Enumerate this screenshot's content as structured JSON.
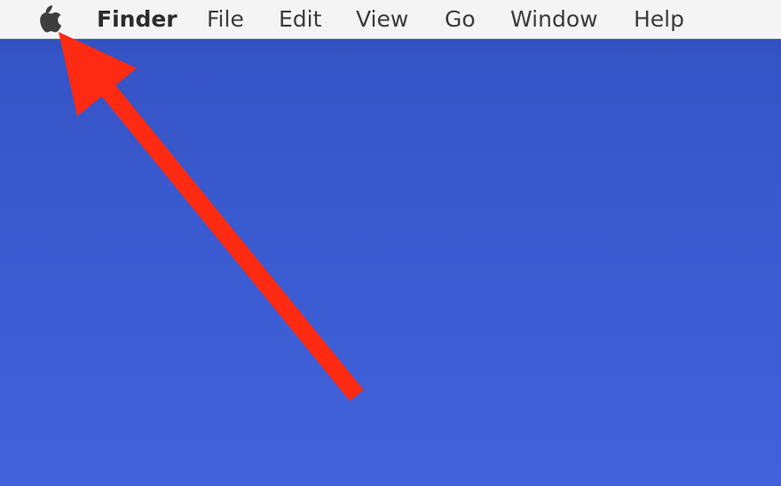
{
  "menubar": {
    "apple_icon": "apple-logo-icon",
    "items": [
      {
        "label": "Finder"
      },
      {
        "label": "File"
      },
      {
        "label": "Edit"
      },
      {
        "label": "View"
      },
      {
        "label": "Go"
      },
      {
        "label": "Window"
      },
      {
        "label": "Help"
      }
    ]
  },
  "annotation": {
    "icon": "arrow-icon",
    "color": "#ff2a12"
  },
  "colors": {
    "menubar_bg": "#f4f4f4",
    "menu_text": "#3b3b3b",
    "desktop_top": "#2f4cb4",
    "desktop_bottom": "#4262dc"
  }
}
